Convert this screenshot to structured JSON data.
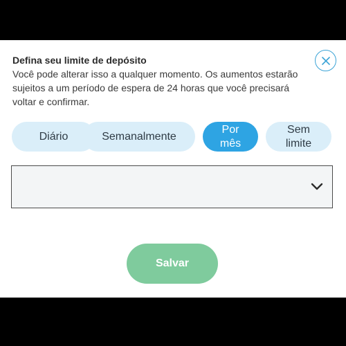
{
  "dialog": {
    "title": "Defina seu limite de depósito",
    "description": "Você pode alterar isso a qualquer momento. Os aumentos estarão sujeitos a um período de espera de 24 horas que você precisará voltar e confirmar."
  },
  "close": {
    "icon": "close-icon",
    "color": "#3aa3d6"
  },
  "tabs": [
    {
      "label": "Diário",
      "active": false
    },
    {
      "label": "Semanalmente",
      "active": false
    },
    {
      "label": "Por mês",
      "active": true
    },
    {
      "label": "Sem limite",
      "active": false
    }
  ],
  "limit_select": {
    "value": "",
    "icon": "chevron-down-icon"
  },
  "save": {
    "label": "Salvar",
    "color": "#7fcb9d"
  },
  "colors": {
    "accent": "#2ea4e3",
    "tab_inactive": "#daeef9"
  }
}
